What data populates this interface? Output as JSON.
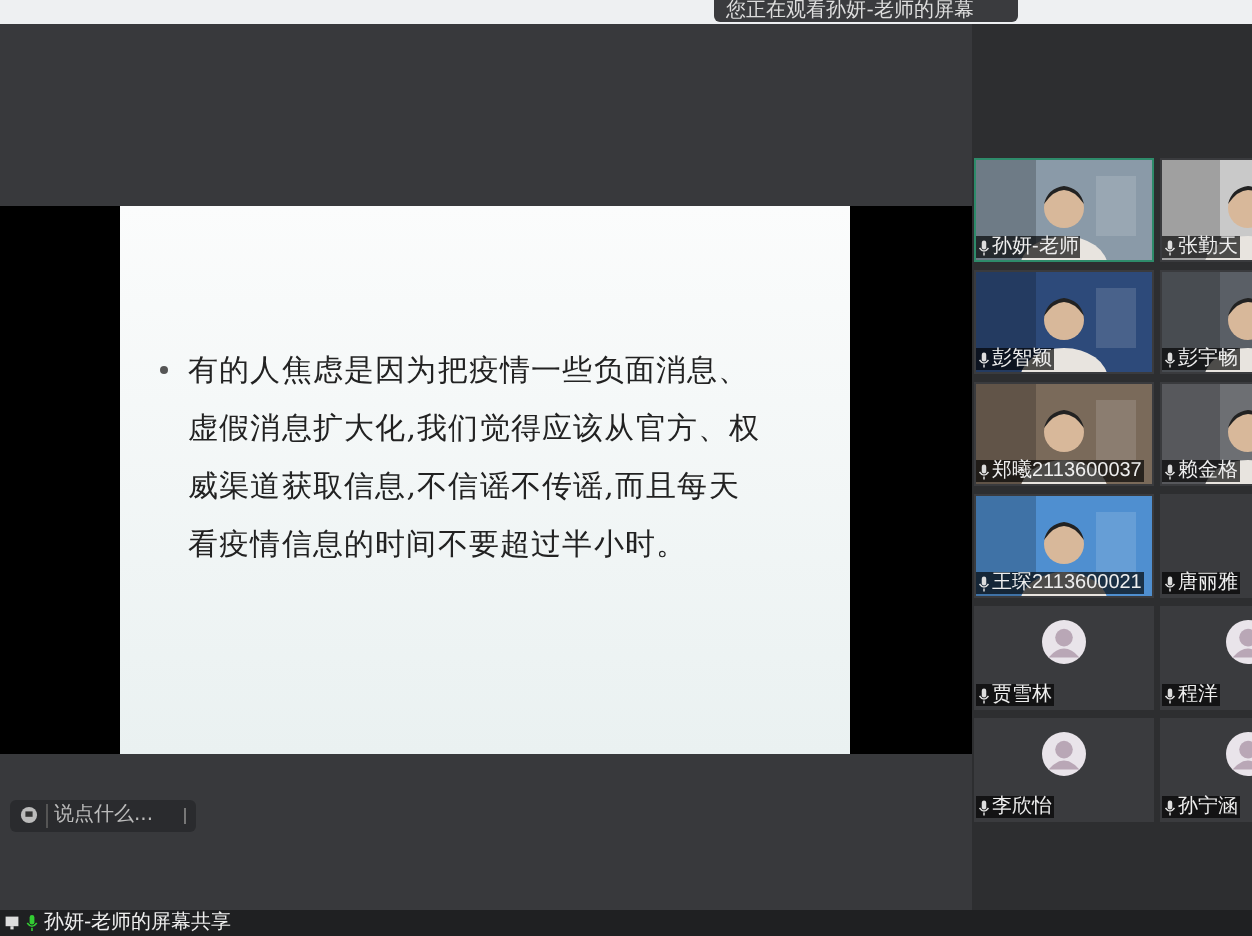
{
  "banner": {
    "text": "您正在观看孙妍-老师的屏幕"
  },
  "slide": {
    "bullets": [
      "有的人焦虑是因为把疫情一些负面消息、虚假消息扩大化,我们觉得应该从官方、权威渠道获取信息,不信谣不传谣,而且每天看疫情信息的时间不要超过半小时。"
    ]
  },
  "chat": {
    "placeholder": "说点什么..."
  },
  "participants": [
    {
      "name": "孙妍-老师",
      "kind": "video",
      "selected": true
    },
    {
      "name": "张勤天",
      "kind": "video",
      "selected": false
    },
    {
      "name": "彭智颖",
      "kind": "video",
      "selected": false
    },
    {
      "name": "彭宇畅",
      "kind": "video",
      "selected": false
    },
    {
      "name": "郑曦2113600037",
      "kind": "video",
      "selected": false
    },
    {
      "name": "赖金格",
      "kind": "video",
      "selected": false
    },
    {
      "name": "王琛2113600021",
      "kind": "video",
      "selected": false
    },
    {
      "name": "唐丽雅",
      "kind": "blank",
      "selected": false
    },
    {
      "name": "贾雪林",
      "kind": "avatar",
      "selected": false
    },
    {
      "name": "程洋",
      "kind": "avatar",
      "selected": false
    },
    {
      "name": "李欣怡",
      "kind": "avatar",
      "selected": false
    },
    {
      "name": "孙宁涵",
      "kind": "avatar",
      "selected": false
    }
  ],
  "status_bar": {
    "share_label": "孙妍-老师的屏幕共享"
  }
}
